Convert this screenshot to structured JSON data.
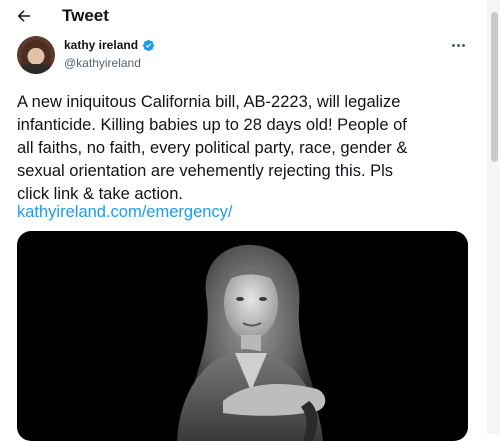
{
  "header": {
    "back_icon": "arrow-left-icon",
    "title": "Tweet"
  },
  "author": {
    "name": "kathy ireland",
    "handle": "@kathyireland",
    "verified_icon": "verified-badge-icon",
    "avatar_icon": "profile-avatar"
  },
  "actions": {
    "more_icon": "more-horizontal-icon"
  },
  "tweet": {
    "lines": [
      "A new iniquitous California bill, AB-2223, will legalize",
      "infanticide. Killing babies up to 28 days old! People of",
      "all faiths, no faith, every political party, race, gender &",
      "sexual orientation are vehemently rejecting this. Pls",
      "click link & take action."
    ],
    "link": "kathyireland.com/emergency/"
  },
  "media": {
    "kind": "black-and-white portrait photo"
  },
  "colors": {
    "accent": "#1d9bf0",
    "text": "#0f1419",
    "secondary": "#536471",
    "media_bg": "#000000"
  }
}
